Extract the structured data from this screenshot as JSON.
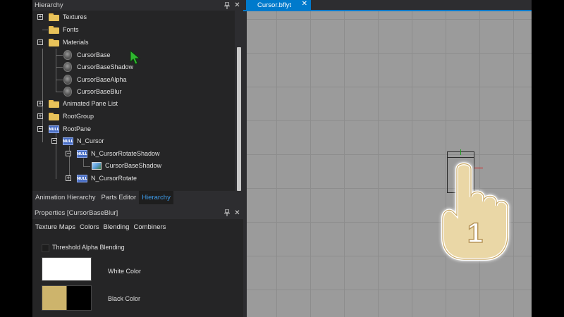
{
  "hierarchy_panel": {
    "title": "Hierarchy",
    "tree": [
      {
        "label": "Textures",
        "icon": "folder-icon",
        "expander": "+"
      },
      {
        "label": "Fonts",
        "icon": "folder-icon",
        "expander": ""
      },
      {
        "label": "Materials",
        "icon": "folder-icon",
        "expander": "−"
      },
      {
        "label": "CursorBase",
        "icon": "material-icon",
        "expander": ""
      },
      {
        "label": "CursorBaseShadow",
        "icon": "material-icon",
        "expander": ""
      },
      {
        "label": "CursorBaseAlpha",
        "icon": "material-icon",
        "expander": ""
      },
      {
        "label": "CursorBaseBlur",
        "icon": "material-icon",
        "expander": ""
      },
      {
        "label": "Animated Pane List",
        "icon": "folder-icon",
        "expander": "+"
      },
      {
        "label": "RootGroup",
        "icon": "folder-icon",
        "expander": "+"
      },
      {
        "label": "RootPane",
        "icon": "null-pane-icon",
        "expander": "−"
      },
      {
        "label": "N_Cursor",
        "icon": "null-pane-icon",
        "expander": "−"
      },
      {
        "label": "N_CursorRotateShadow",
        "icon": "null-pane-icon",
        "expander": "−"
      },
      {
        "label": "CursorBaseShadow",
        "icon": "picture-pane-icon",
        "expander": ""
      },
      {
        "label": "N_CursorRotate",
        "icon": "null-pane-icon",
        "expander": "+"
      }
    ],
    "null_badge": "NULL"
  },
  "bottom_tabs": [
    {
      "label": "Animation Hierarchy",
      "active": false
    },
    {
      "label": "Parts Editor",
      "active": false
    },
    {
      "label": "Hierarchy",
      "active": true
    }
  ],
  "properties_panel": {
    "title": "Properties [CursorBaseBlur]",
    "tabs": [
      "Texture Maps",
      "Colors",
      "Blending",
      "Combiners"
    ],
    "threshold_label": "Threshold Alpha Blending",
    "white_color_label": "White Color",
    "black_color_label": "Black Color",
    "white_color": "#ffffff",
    "black_color_left": "#cdb46c",
    "black_color_right": "#000000"
  },
  "document": {
    "tab_label": "Cursor.bflyt",
    "close_glyph": "✕"
  },
  "hand_badge": "1",
  "panel_buttons": {
    "pin": "📌",
    "close": "✕"
  },
  "colors": {
    "accent": "#007acc",
    "active_tab_text": "#3d9be9",
    "canvas": "#9b9b9b",
    "folder": "#e8c25a"
  }
}
